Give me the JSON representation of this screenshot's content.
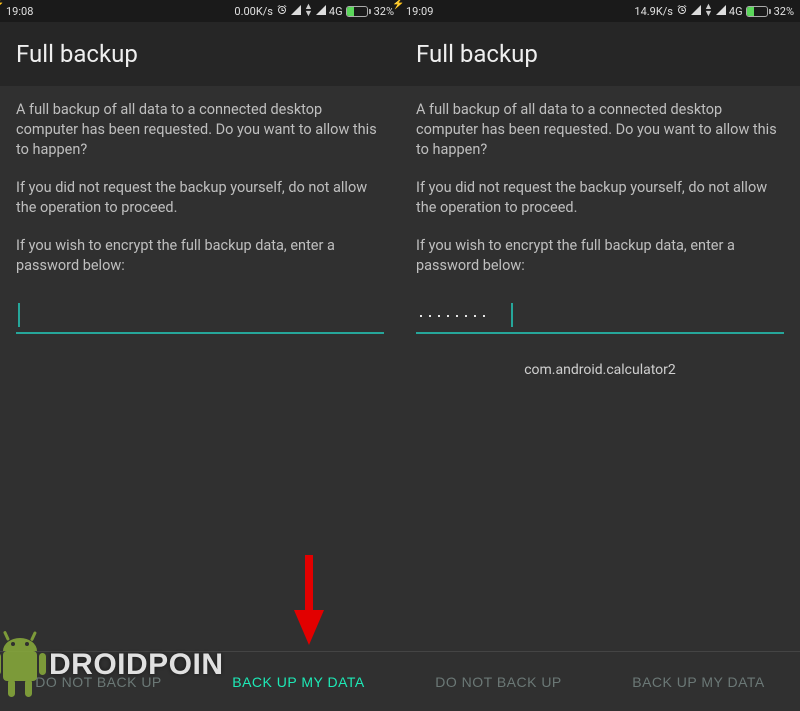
{
  "screens": [
    {
      "status": {
        "time": "19:08",
        "speed": "0.00K/s",
        "net": "4G",
        "battery_pct": "32%"
      },
      "title": "Full backup",
      "p1": "A full backup of all data to a connected desktop computer has been requested. Do you want to allow this to happen?",
      "p2": "If you did not request the backup yourself, do not allow the operation to proceed.",
      "p3": "If you wish to encrypt the full backup data, enter a password below:",
      "password": "",
      "package": "",
      "deny": "DO NOT BACK UP",
      "confirm": "BACK UP MY DATA",
      "focus": "confirm"
    },
    {
      "status": {
        "time": "19:09",
        "speed": "14.9K/s",
        "net": "4G",
        "battery_pct": "32%"
      },
      "title": "Full backup",
      "p1": "A full backup of all data to a connected desktop computer has been requested. Do you want to allow this to happen?",
      "p2": "If you did not request the backup yourself, do not allow the operation to proceed.",
      "p3": "If you wish to encrypt the full backup data, enter a password below:",
      "password": "········",
      "package": "com.android.calculator2",
      "deny": "DO NOT BACK UP",
      "confirm": "BACK UP MY DATA",
      "focus": "none"
    }
  ],
  "watermark": "DROIDPOIN"
}
